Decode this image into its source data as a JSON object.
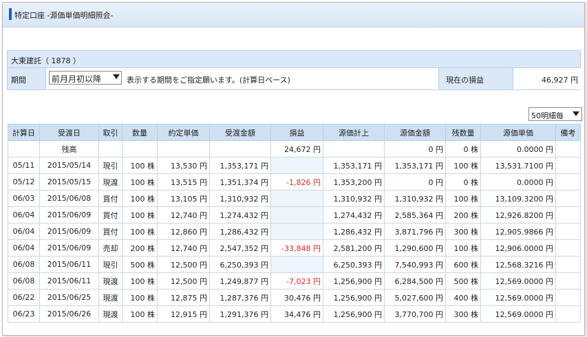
{
  "header": {
    "title": "特定口座 -源価単価明細照会-"
  },
  "stock": {
    "name_code": "大東建託（ 1878 ）"
  },
  "period": {
    "label": "期間",
    "selected": "前月月初以降",
    "note": "表示する期間をご指定願います。(計算日ベース)"
  },
  "current_pl": {
    "label": "現在の損益",
    "value": "46,927 円"
  },
  "page_select": {
    "selected": "50明細毎"
  },
  "table": {
    "headers": [
      "計算日",
      "受渡日",
      "取引",
      "数量",
      "約定単価",
      "受渡金額",
      "損益",
      "源価計上",
      "源価金額",
      "残数量",
      "源価単価",
      "備考"
    ],
    "rows": [
      [
        "",
        "残高",
        "",
        "",
        "",
        "",
        "24,672 円",
        "",
        "0 円",
        "0 株",
        "0.0000 円",
        ""
      ],
      [
        "05/11",
        "2015/05/14",
        "現引",
        "100 株",
        "13,530 円",
        "1,353,171 円",
        "",
        "1,353,171 円",
        "1,353,171 円",
        "100 株",
        "13,531.7100 円",
        ""
      ],
      [
        "05/12",
        "2015/05/15",
        "現渡",
        "100 株",
        "13,515 円",
        "1,351,374 円",
        "-1,826 円",
        "1,353,200 円",
        "0 円",
        "0 株",
        "0.0000 円",
        ""
      ],
      [
        "06/03",
        "2015/06/08",
        "買付",
        "100 株",
        "13,105 円",
        "1,310,932 円",
        "",
        "1,310,932 円",
        "1,310,932 円",
        "100 株",
        "13,109.3200 円",
        ""
      ],
      [
        "06/04",
        "2015/06/09",
        "買付",
        "100 株",
        "12,740 円",
        "1,274,432 円",
        "",
        "1,274,432 円",
        "2,585,364 円",
        "200 株",
        "12,926.8200 円",
        ""
      ],
      [
        "06/04",
        "2015/06/09",
        "買付",
        "100 株",
        "12,860 円",
        "1,286,432 円",
        "",
        "1,286,432 円",
        "3,871,796 円",
        "300 株",
        "12,905.9866 円",
        ""
      ],
      [
        "06/04",
        "2015/06/09",
        "売却",
        "200 株",
        "12,740 円",
        "2,547,352 円",
        "-33,848 円",
        "2,581,200 円",
        "1,290,600 円",
        "100 株",
        "12,906.0000 円",
        ""
      ],
      [
        "06/08",
        "2015/06/11",
        "現引",
        "500 株",
        "12,500 円",
        "6,250,393 円",
        "",
        "6,250,393 円",
        "7,540,993 円",
        "600 株",
        "12,568.3216 円",
        ""
      ],
      [
        "06/08",
        "2015/06/11",
        "現渡",
        "100 株",
        "12,500 円",
        "1,249,877 円",
        "-7,023 円",
        "1,256,900 円",
        "6,284,500 円",
        "500 株",
        "12,569.0000 円",
        ""
      ],
      [
        "06/22",
        "2015/06/25",
        "現渡",
        "100 株",
        "12,875 円",
        "1,287,376 円",
        "30,476 円",
        "1,256,900 円",
        "5,027,600 円",
        "400 株",
        "12,569.0000 円",
        ""
      ],
      [
        "06/23",
        "2015/06/26",
        "現渡",
        "100 株",
        "12,915 円",
        "1,291,376 円",
        "34,476 円",
        "1,256,900 円",
        "3,770,700 円",
        "300 株",
        "12,569.0000 円",
        ""
      ]
    ]
  },
  "colors": {
    "accent": "#1f5fbf",
    "header_bg": "#cfe0f3",
    "negative": "#e0262a"
  }
}
